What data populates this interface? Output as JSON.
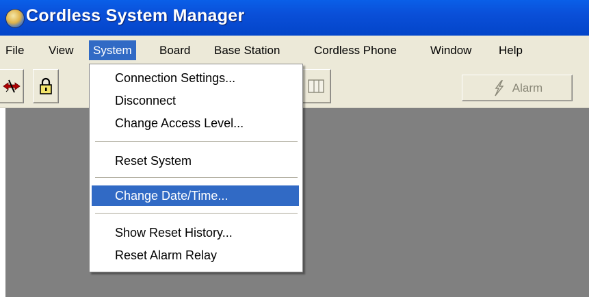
{
  "window": {
    "title": "Cordless System Manager",
    "icon": "globe-app-icon"
  },
  "menubar": {
    "items": [
      {
        "label": "File"
      },
      {
        "label": "View"
      },
      {
        "label": "System",
        "active": true
      },
      {
        "label": "Board"
      },
      {
        "label": "Base Station"
      },
      {
        "label": "Cordless Phone"
      },
      {
        "label": "Window"
      },
      {
        "label": "Help"
      }
    ]
  },
  "toolbar": {
    "buttons": [
      {
        "icon": "disconnect-icon"
      },
      {
        "icon": "lock-icon"
      },
      {
        "icon": "window-panel-icon"
      }
    ],
    "alarm": {
      "label": "Alarm",
      "icon": "lightning-icon",
      "enabled": false
    }
  },
  "system_menu": {
    "items": [
      {
        "label": "Connection Settings..."
      },
      {
        "label": "Disconnect"
      },
      {
        "label": "Change Access Level..."
      },
      {
        "label": "Reset System"
      },
      {
        "label": "Change Date/Time...",
        "highlighted": true
      },
      {
        "label": "Show Reset History..."
      },
      {
        "label": "Reset Alarm Relay"
      }
    ]
  },
  "colors": {
    "titlebar": "#0a4fd8",
    "menu_highlight": "#316ac5",
    "workspace": "#808080",
    "chrome": "#ece9d8"
  }
}
